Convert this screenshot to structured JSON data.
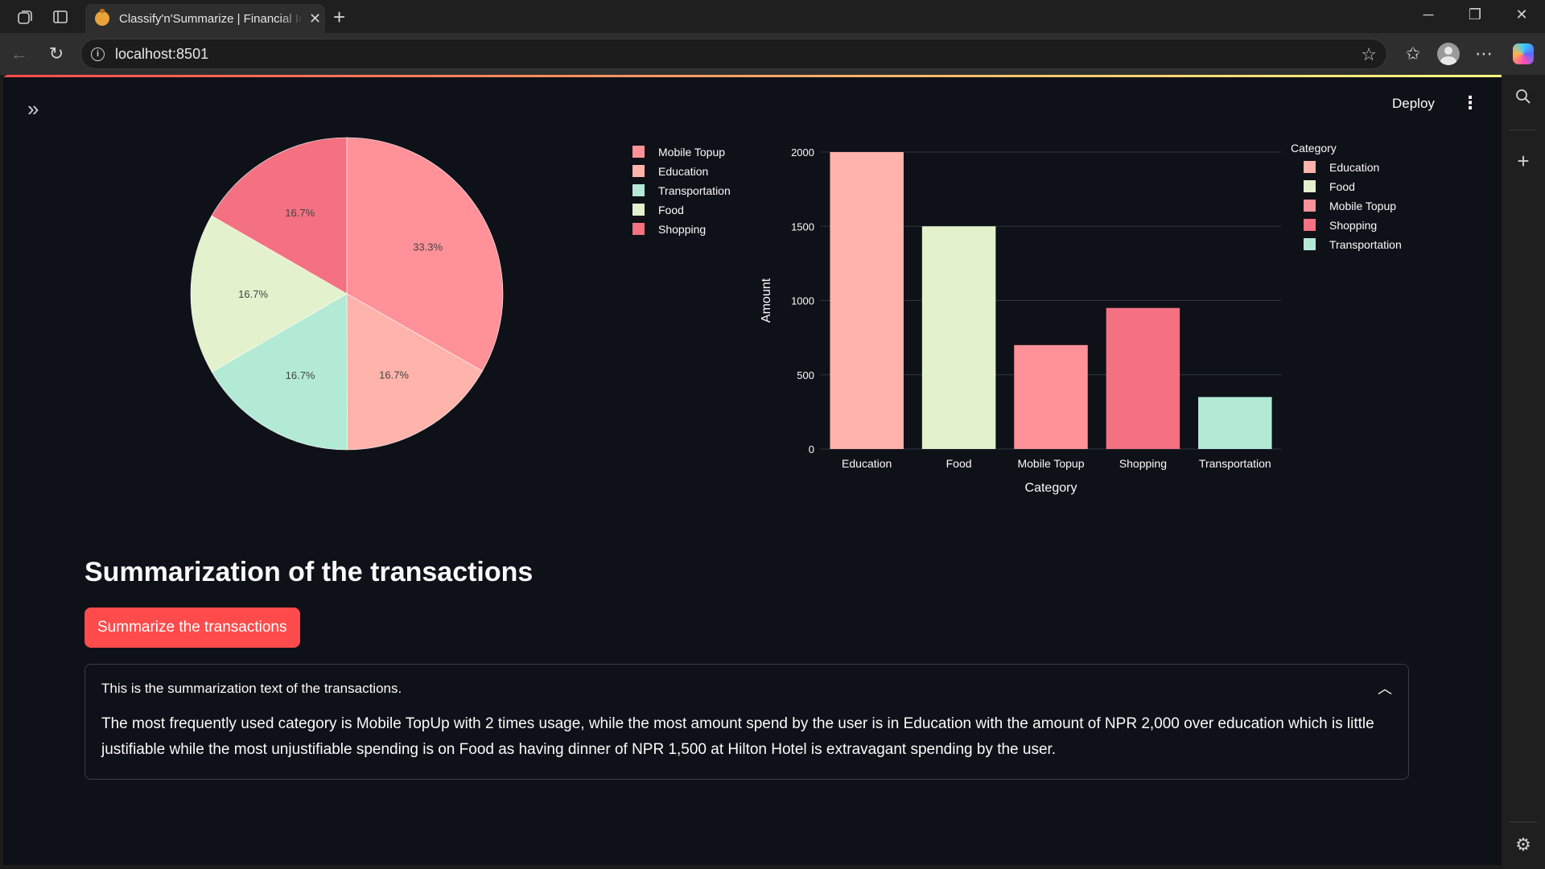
{
  "browser": {
    "tab_title": "Classify'n'Summarize | Financial Insights",
    "url": "localhost:8501"
  },
  "app": {
    "deploy_label": "Deploy",
    "summary_heading": "Summarization of the transactions",
    "summarize_button": "Summarize the transactions",
    "expander_label": "This is the summarization text of the transactions.",
    "summary_text": "The most frequently used category is Mobile TopUp with 2 times usage, while the most amount spend by the user is in Education with the amount of NPR 2,000 over education which is little justifiable while the most unjustifiable spending is on Food as having dinner of NPR 1,500 at Hilton Hotel is extravagant spending by the user."
  },
  "chart_data": [
    {
      "type": "pie",
      "labels": [
        "Mobile Topup",
        "Education",
        "Transportation",
        "Food",
        "Shopping"
      ],
      "values": [
        33.3,
        16.7,
        16.7,
        16.7,
        16.7
      ],
      "text_labels": [
        "33.3%",
        "16.7%",
        "16.7%",
        "16.7%",
        "16.7%"
      ],
      "colors": [
        "#ff9199",
        "#ffb3ab",
        "#b3ead6",
        "#e3f1cc",
        "#f47181"
      ],
      "legend_position": "right"
    },
    {
      "type": "bar",
      "categories": [
        "Education",
        "Food",
        "Mobile Topup",
        "Shopping",
        "Transportation"
      ],
      "values": [
        2000,
        1500,
        700,
        950,
        350
      ],
      "colors": [
        "#ffb3ab",
        "#e3f1cc",
        "#ff9199",
        "#f47181",
        "#b3ead6"
      ],
      "xlabel": "Category",
      "ylabel": "Amount",
      "ylim": [
        0,
        2000
      ],
      "yticks": [
        0,
        500,
        1000,
        1500,
        2000
      ],
      "legend_title": "Category",
      "legend_entries": [
        "Education",
        "Food",
        "Mobile Topup",
        "Shopping",
        "Transportation"
      ],
      "legend_position": "top-right",
      "grid": true
    }
  ]
}
